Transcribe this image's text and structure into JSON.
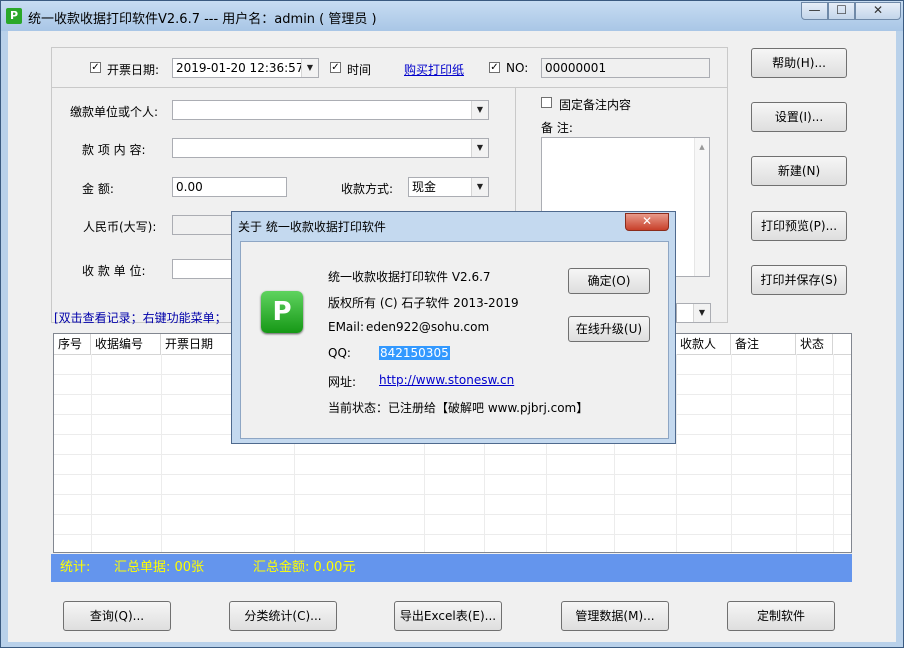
{
  "window": {
    "title": "统一收款收据打印软件V2.6.7 --- 用户名：admin ( 管理员 )",
    "app_icon": "P",
    "min_glyph": "—",
    "max_glyph": "☐",
    "close_glyph": "✕"
  },
  "top": {
    "date_label": "开票日期:",
    "date_value": "2019-01-20 12:36:57",
    "time_label": "时间",
    "buy_paper_link": "购买打印纸",
    "no_label": "NO:",
    "no_value": "00000001"
  },
  "form": {
    "payer_label": "缴款单位或个人:",
    "item_label": "款 项 内 容:",
    "amount_label": "金        额:",
    "amount_value": "0.00",
    "method_label": "收款方式:",
    "method_value": "现金",
    "rmb_label": "人民币(大写):",
    "receiver_label": "收 款 单 位:",
    "fixed_note_label": "固定备注内容",
    "note_label": "备 注:"
  },
  "hint_text": "[双击查看记录；右键功能菜单；",
  "side_buttons": {
    "help": "帮助(H)...",
    "settings": "设置(I)...",
    "new": "新建(N)",
    "preview": "打印预览(P)...",
    "print_save": "打印并保存(S)"
  },
  "table": {
    "columns": [
      "序号",
      "收据编号",
      "开票日期",
      "收款人",
      "备注",
      "状态"
    ]
  },
  "status": {
    "stats_label": "统计:",
    "count_text": "汇总单据: 00张",
    "amount_text": "汇总金额: 0.00元"
  },
  "bottom_buttons": {
    "query": "查询(Q)...",
    "category_stats": "分类统计(C)...",
    "export_excel": "导出Excel表(E)...",
    "manage_data": "管理数据(M)...",
    "customize": "定制软件"
  },
  "dialog": {
    "title": "关于 统一收款收据打印软件",
    "close_glyph": "✕",
    "logo": "P",
    "product": "统一收款收据打印软件 V2.6.7",
    "copyright": "版权所有 (C) 石子软件 2013-2019",
    "email_label": "EMail:",
    "email_value": "eden922@sohu.com",
    "qq_label": "QQ:",
    "qq_value": "842150305",
    "site_label": "网址:",
    "site_value": "http://www.stonesw.cn",
    "status_text": "当前状态：已注册给【破解吧 www.pjbrj.com】",
    "ok_button": "确定(O)",
    "upgrade_button": "在线升级(U)"
  }
}
